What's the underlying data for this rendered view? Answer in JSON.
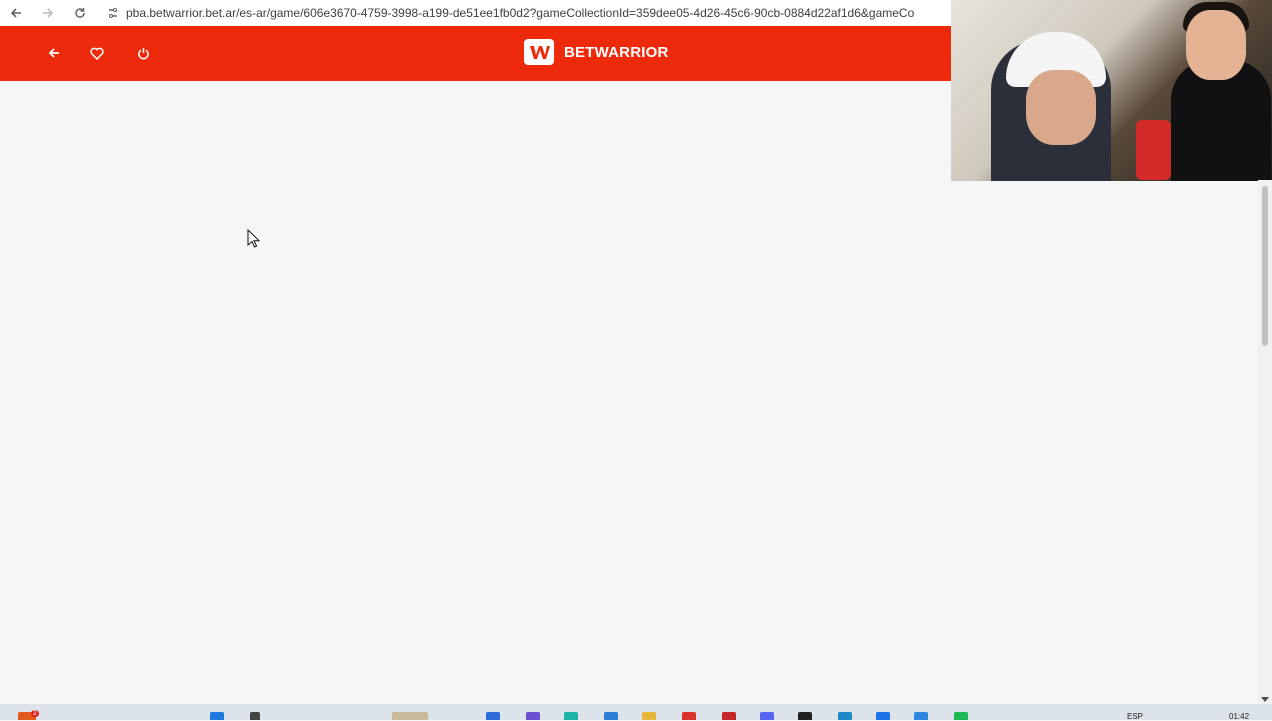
{
  "browser": {
    "url": "pba.betwarrior.bet.ar/es-ar/game/606e3670-4759-3998-a199-de51ee1fb0d2?gameCollectionId=359dee05-4d26-45c6-90cb-0884d22af1d6&gameCo",
    "back_icon": "arrow-left-icon",
    "forward_icon": "arrow-right-icon",
    "reload_icon": "reload-icon",
    "site_info_icon": "site-settings-icon"
  },
  "header": {
    "background_color": "#ee2a0d",
    "back_icon": "arrow-left-icon",
    "favorite_icon": "heart-icon",
    "power_icon": "power-icon",
    "brand_name": "BETWARRIOR"
  },
  "taskbar": {
    "language": "ESP",
    "time": "01:42",
    "notification_badge": "2"
  }
}
